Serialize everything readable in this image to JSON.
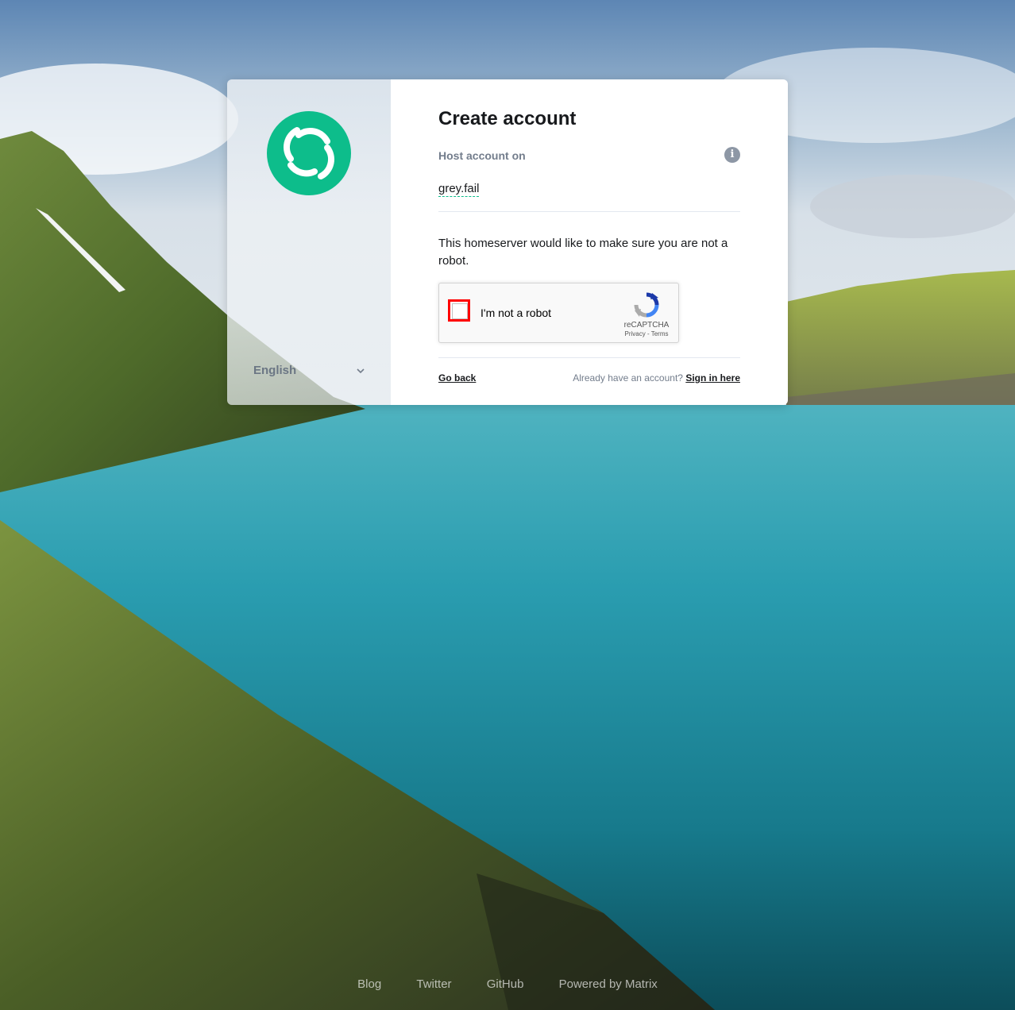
{
  "register": {
    "title": "Create account",
    "host_label": "Host account on",
    "server_name": "grey.fail",
    "robot_text": "This homeserver would like to make sure you are not a robot.",
    "go_back": "Go back",
    "already_text": "Already have an account?",
    "sign_in": "Sign in here"
  },
  "recaptcha": {
    "label": "I'm not a robot",
    "brand": "reCAPTCHA",
    "privacy": "Privacy",
    "separator": "-",
    "terms": "Terms"
  },
  "language": {
    "selected": "English"
  },
  "footer": {
    "links": [
      "Blog",
      "Twitter",
      "GitHub",
      "Powered by Matrix"
    ]
  },
  "colors": {
    "accent": "#0dbd8b",
    "captcha_highlight": "#ff0000"
  },
  "icons": {
    "logo": "element-logo-icon",
    "info": "info-icon",
    "chevron": "chevron-down-icon",
    "recaptcha": "recaptcha-logo-icon"
  }
}
